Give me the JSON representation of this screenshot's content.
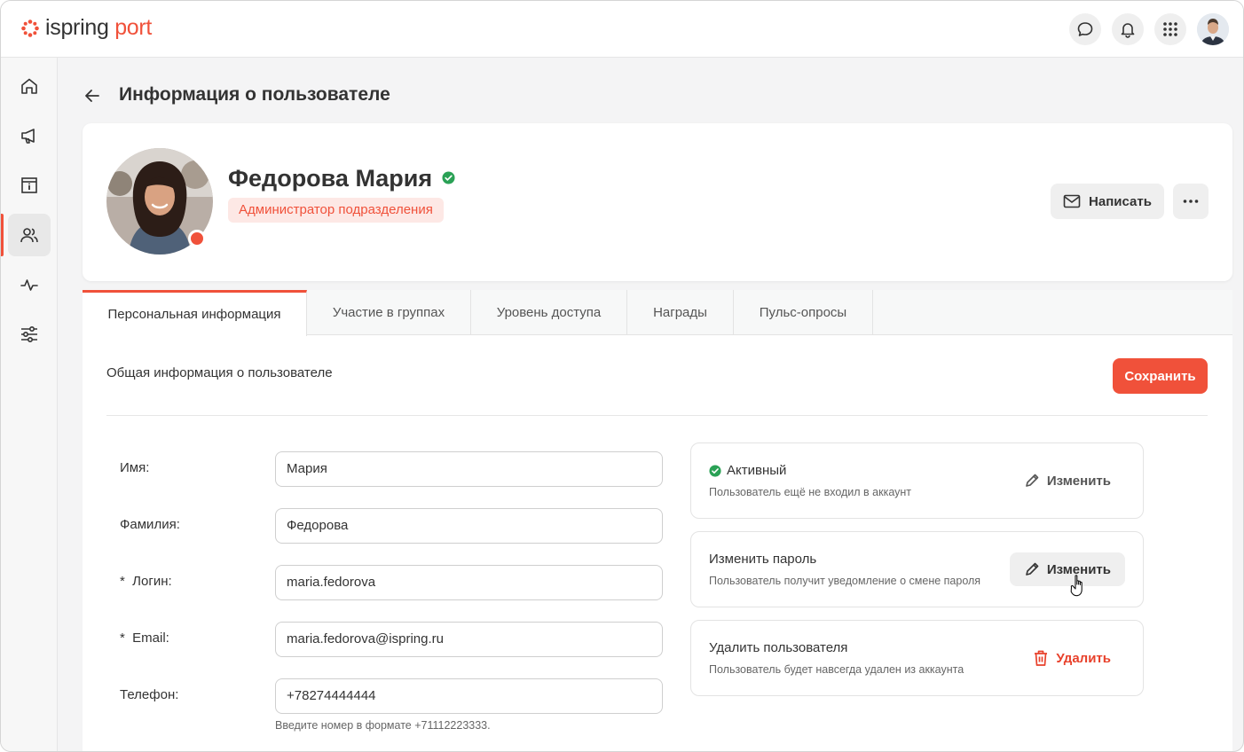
{
  "app": {
    "logo_main": "ispring",
    "logo_accent": "port",
    "accent_color": "#f0513a"
  },
  "topbar": {
    "icons": [
      "chat-icon",
      "bell-icon",
      "apps-grid-icon"
    ]
  },
  "sidebar": {
    "items": [
      "home-icon",
      "megaphone-icon",
      "info-board-icon",
      "users-icon",
      "activity-icon",
      "settings-sliders-icon"
    ],
    "active_index": 3
  },
  "page": {
    "title": "Информация о пользователе"
  },
  "profile": {
    "name": "Федорова Мария",
    "role": "Администратор подразделения",
    "write_label": "Написать",
    "status_color": "#f0513a"
  },
  "tabs": [
    {
      "label": "Персональная информация",
      "active": true
    },
    {
      "label": "Участие в группах",
      "active": false
    },
    {
      "label": "Уровень доступа",
      "active": false
    },
    {
      "label": "Награды",
      "active": false
    },
    {
      "label": "Пульс-опросы",
      "active": false
    }
  ],
  "form": {
    "section_title": "Общая информация о пользователе",
    "save_label": "Сохранить",
    "fields": [
      {
        "label": "Имя:",
        "value": "Мария"
      },
      {
        "label": "Фамилия:",
        "value": "Федорова"
      },
      {
        "label": "*  Логин:",
        "value": "maria.fedorova"
      },
      {
        "label": "*  Email:",
        "value": "maria.fedorova@ispring.ru"
      },
      {
        "label": "Телефон:",
        "value": "+78274444444"
      }
    ],
    "phone_hint": "Введите номер в формате +71112223333."
  },
  "boxes": [
    {
      "title": "Активный",
      "subtitle": "Пользователь ещё не входил в аккаунт",
      "action": "Изменить"
    },
    {
      "title": "Изменить пароль",
      "subtitle": "Пользователь получит уведомление о смене пароля",
      "action": "Изменить"
    },
    {
      "title": "Удалить пользователя",
      "subtitle": "Пользователь будет навсегда удален из аккаунта",
      "action": "Удалить"
    }
  ]
}
